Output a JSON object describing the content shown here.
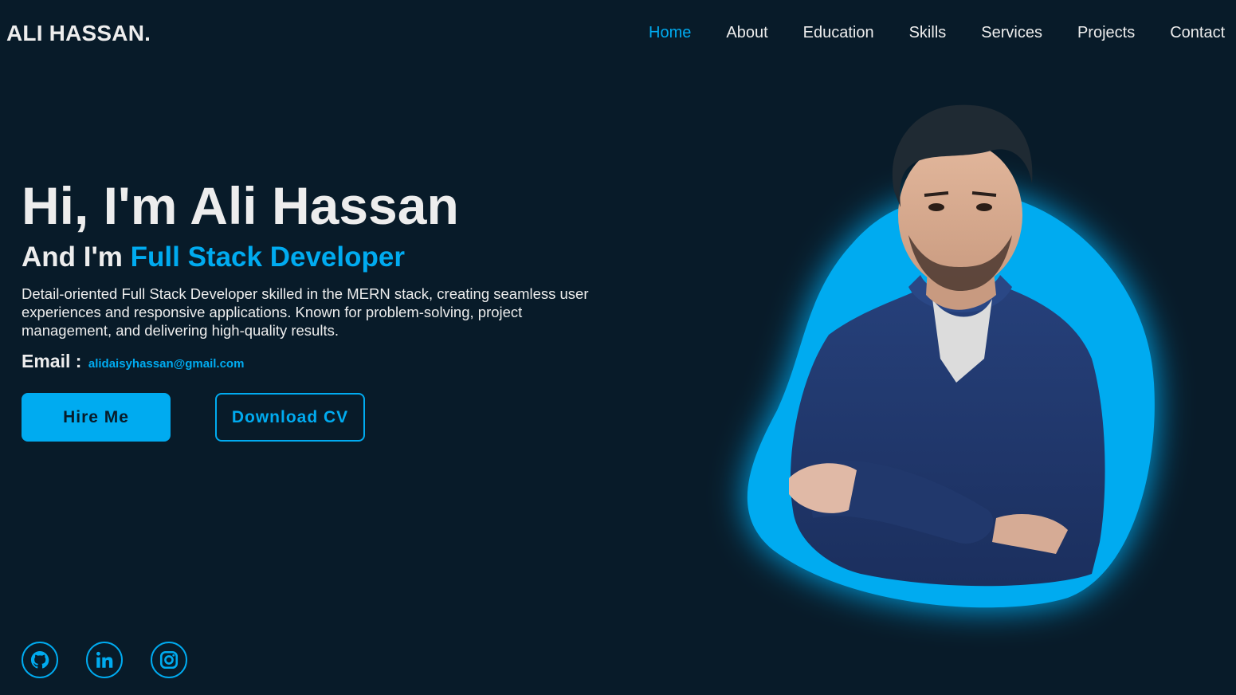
{
  "header": {
    "logo": "ALI HASSAN.",
    "nav": [
      {
        "label": "Home",
        "active": true
      },
      {
        "label": "About",
        "active": false
      },
      {
        "label": "Education",
        "active": false
      },
      {
        "label": "Skills",
        "active": false
      },
      {
        "label": "Services",
        "active": false
      },
      {
        "label": "Projects",
        "active": false
      },
      {
        "label": "Contact",
        "active": false
      }
    ]
  },
  "hero": {
    "title": "Hi, I'm Ali Hassan",
    "subtitle_prefix": "And I'm ",
    "subtitle_role": "Full Stack Developer",
    "description": "Detail-oriented Full Stack Developer skilled in the MERN stack, creating seamless user experiences and responsive applications. Known for problem-solving, project management, and delivering high-quality results.",
    "email_label": "Email :",
    "email_value": "alidaisyhassan@gmail.com",
    "hire_button": "Hire Me",
    "cv_button": "Download CV"
  },
  "social": [
    {
      "icon": "github-icon"
    },
    {
      "icon": "linkedin-icon"
    },
    {
      "icon": "instagram-icon"
    }
  ],
  "colors": {
    "background": "#081b29",
    "accent": "#00abf0",
    "text": "#ededed"
  }
}
